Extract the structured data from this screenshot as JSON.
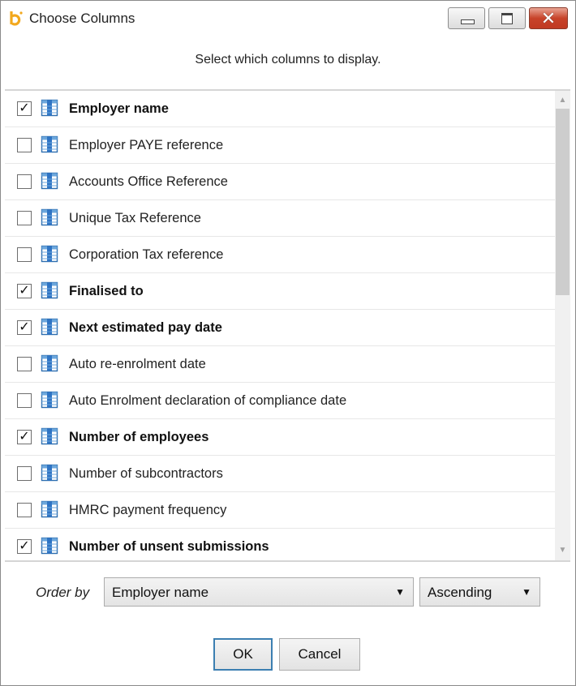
{
  "window": {
    "title": "Choose Columns",
    "close_glyph": "✕"
  },
  "instruction": "Select which columns to display.",
  "columns": [
    {
      "label": "Employer name",
      "checked": true
    },
    {
      "label": "Employer PAYE reference",
      "checked": false
    },
    {
      "label": "Accounts Office Reference",
      "checked": false
    },
    {
      "label": "Unique Tax Reference",
      "checked": false
    },
    {
      "label": "Corporation Tax reference",
      "checked": false
    },
    {
      "label": "Finalised to",
      "checked": true
    },
    {
      "label": "Next estimated pay date",
      "checked": true
    },
    {
      "label": "Auto re-enrolment date",
      "checked": false
    },
    {
      "label": "Auto Enrolment declaration of compliance date",
      "checked": false
    },
    {
      "label": "Number of employees",
      "checked": true
    },
    {
      "label": "Number of subcontractors",
      "checked": false
    },
    {
      "label": "HMRC payment frequency",
      "checked": false
    },
    {
      "label": "Number of unsent submissions",
      "checked": true
    }
  ],
  "scrollbar": {
    "up_glyph": "▲",
    "down_glyph": "▼"
  },
  "order": {
    "label": "Order by",
    "field": "Employer name",
    "direction": "Ascending",
    "arrow_glyph": "▼"
  },
  "buttons": {
    "ok": "OK",
    "cancel": "Cancel"
  },
  "colors": {
    "accent": "#3c7fb1",
    "close": "#c7432a",
    "logo": "#f2a81d"
  }
}
